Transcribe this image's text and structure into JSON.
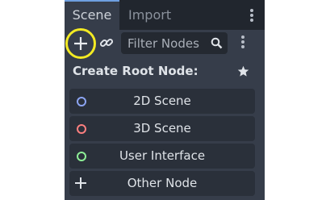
{
  "tabs": [
    {
      "label": "Scene",
      "active": true
    },
    {
      "label": "Import",
      "active": false
    }
  ],
  "toolbar": {
    "add_icon": "plus-icon",
    "link_icon": "link-icon",
    "filter_placeholder": "Filter Nodes",
    "search_icon": "search-icon",
    "menu_icon": "vertical-dots-icon"
  },
  "create_root": {
    "heading": "Create Root Node:",
    "favorite_icon": "star-icon",
    "options": [
      {
        "label": "2D Scene",
        "icon": "node2d-circle-icon",
        "color": "#8da5f3"
      },
      {
        "label": "3D Scene",
        "icon": "node3d-circle-icon",
        "color": "#fc7f7f"
      },
      {
        "label": "User Interface",
        "icon": "control-circle-icon",
        "color": "#8eef97"
      },
      {
        "label": "Other Node",
        "icon": "plus-icon",
        "color": "#e0e0e0"
      }
    ]
  },
  "colors": {
    "panel_bg": "#363d4a",
    "tabbar_bg": "#21262e",
    "highlight": "#f3ea23"
  }
}
